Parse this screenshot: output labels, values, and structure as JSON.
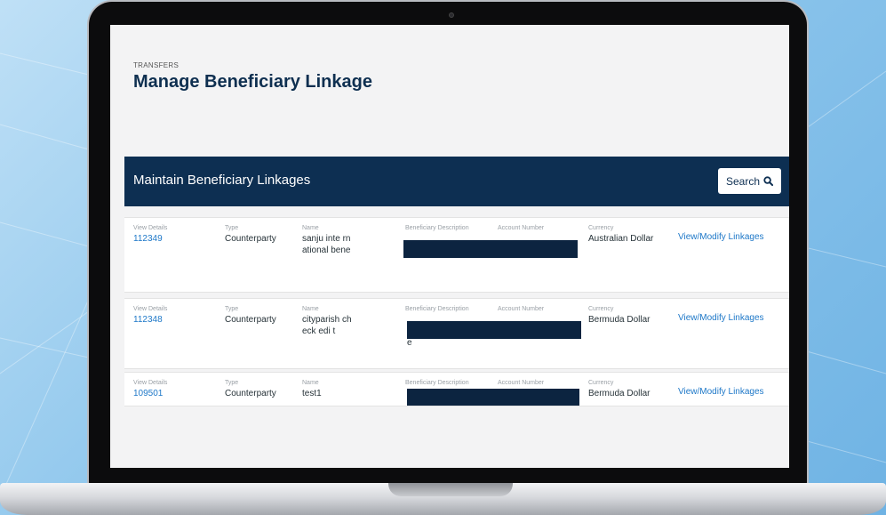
{
  "page": {
    "breadcrumb": "TRANSFERS",
    "title": "Manage Beneficiary Linkage"
  },
  "section": {
    "title": "Maintain Beneficiary Linkages",
    "search_label": "Search"
  },
  "labels": {
    "view_details": "View Details",
    "type": "Type",
    "name": "Name",
    "beneficiary_description": "Beneficiary Description",
    "account_number": "Account Number",
    "currency": "Currency"
  },
  "rows": [
    {
      "id": "112349",
      "type": "Counterparty",
      "name": "sanju inte rnational bene",
      "desc_tail": "",
      "currency": "Australian Dollar",
      "action": "View/Modify Linkages"
    },
    {
      "id": "112348",
      "type": "Counterparty",
      "name": "cityparish check edi t",
      "desc_tail": "e",
      "currency": "Bermuda Dollar",
      "action": "View/Modify Linkages"
    },
    {
      "id": "109501",
      "type": "Counterparty",
      "name": "test1",
      "desc_tail": "",
      "currency": "Bermuda Dollar",
      "action": "View/Modify Linkages"
    }
  ],
  "colors": {
    "navy_header": "#0d2f52",
    "link_blue": "#1e78c8",
    "redaction": "#0c2440"
  },
  "icons": {
    "search": "search-icon"
  }
}
